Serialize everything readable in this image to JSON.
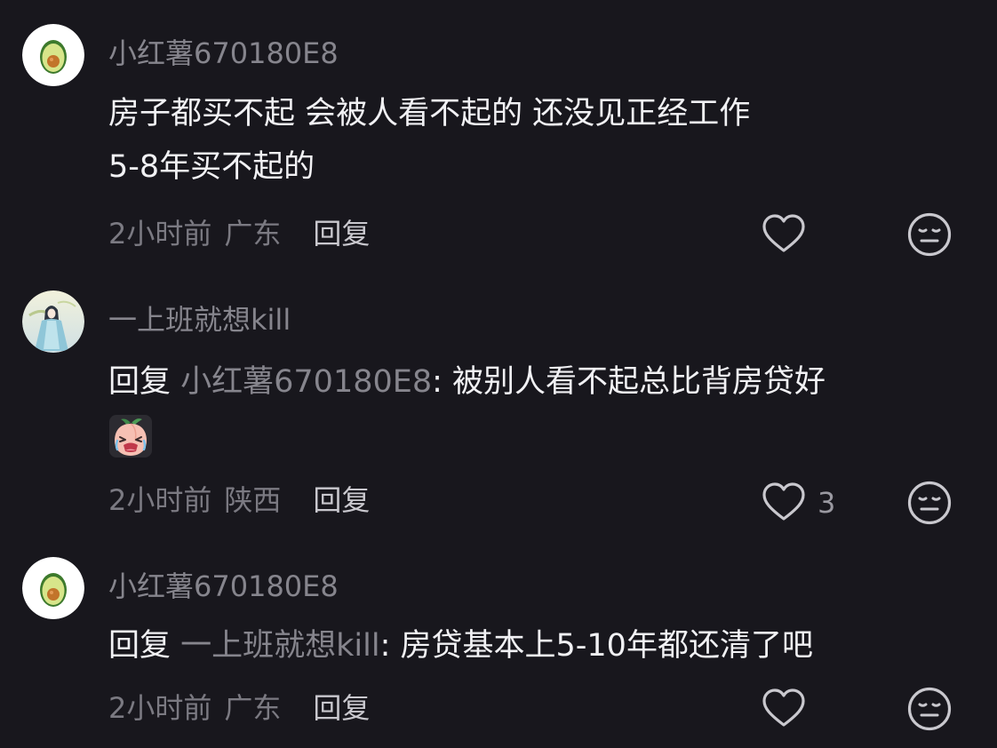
{
  "comments": [
    {
      "username": "小红薯670180E8",
      "avatar_icon": "avocado-icon",
      "line1": "房子都买不起  会被人看不起的  还没见正经工作",
      "line2": " 5-8年买不起的",
      "time": "2小时前",
      "location": "广东",
      "reply_label": "回复",
      "like_count": ""
    },
    {
      "username": "一上班就想kill",
      "avatar_icon": "anime-girl-avatar",
      "reply_prefix": "回复 ",
      "reply_target": "小红薯670180E8",
      "line1": ": 被别人看不起总比背房贷好",
      "sticker": "crying-peach-emoji",
      "time": "2小时前",
      "location": "陕西",
      "reply_label": "回复",
      "like_count": "3"
    },
    {
      "username": "小红薯670180E8",
      "avatar_icon": "avocado-icon",
      "reply_prefix": "回复 ",
      "reply_target": "一上班就想kill",
      "line1": ": 房贷基本上5-10年都还清了吧",
      "time": "2小时前",
      "location": "广东",
      "reply_label": "回复",
      "like_count": ""
    }
  ],
  "colors": {
    "background": "#18171d",
    "username": "#86858d",
    "content": "#f1f1f4",
    "meta": "#7b7a82"
  }
}
